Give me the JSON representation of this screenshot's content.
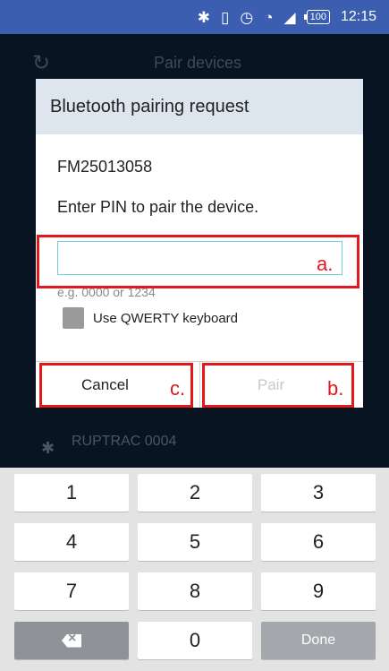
{
  "status_bar": {
    "icons": [
      "bluetooth-icon",
      "vibrate-icon",
      "alarm-icon",
      "wifi-icon",
      "signal-icon"
    ],
    "battery": "100",
    "time": "12:15"
  },
  "background_app": {
    "title": "Pair devices",
    "device_name": "RUPTRAC 0004"
  },
  "dialog": {
    "title": "Bluetooth pairing request",
    "device_name": "FM25013058",
    "prompt": "Enter PIN to pair the device.",
    "pin_value": "",
    "pin_hint": "e.g. 0000 or 1234",
    "qwerty_label": "Use QWERTY keyboard",
    "cancel_label": "Cancel",
    "pair_label": "Pair"
  },
  "annotations": {
    "a": "a.",
    "b": "b.",
    "c": "c.",
    "color": "#e0191b"
  },
  "keyboard": {
    "keys": [
      "1",
      "2",
      "3",
      "4",
      "5",
      "6",
      "7",
      "8",
      "9",
      "0"
    ],
    "done_label": "Done"
  },
  "colors": {
    "status_bar": "#3b5eb1",
    "dialog_header": "#dde6ee",
    "input_border": "#6ed0d2"
  }
}
